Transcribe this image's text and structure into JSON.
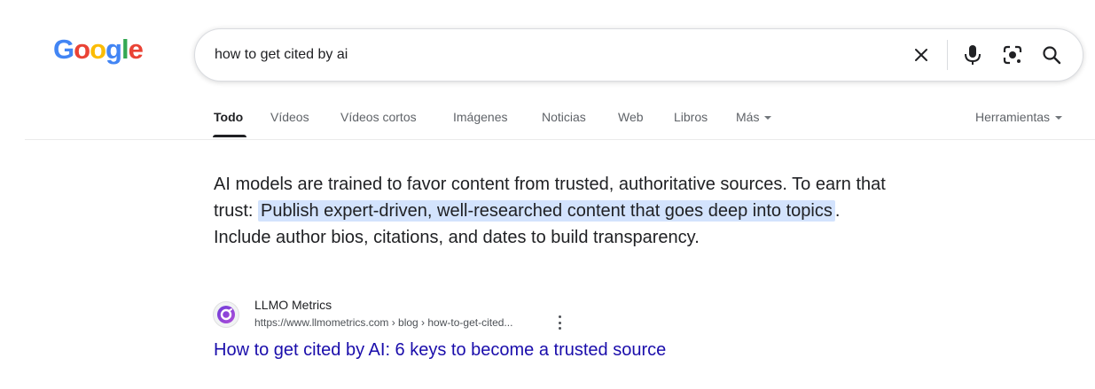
{
  "logo": {
    "letters": [
      "G",
      "o",
      "o",
      "g",
      "l",
      "e"
    ],
    "colors": [
      "#4285F4",
      "#EA4335",
      "#FBBC05",
      "#4285F4",
      "#34A853",
      "#EA4335"
    ]
  },
  "search": {
    "query": "how to get cited by ai",
    "clear_icon": "close-icon",
    "voice_icon": "microphone-icon",
    "lens_icon": "lens-camera-icon",
    "search_icon": "search-icon"
  },
  "tabs": {
    "items": [
      {
        "label": "Todo",
        "active": true
      },
      {
        "label": "Vídeos",
        "active": false
      },
      {
        "label": "Vídeos cortos",
        "active": false
      },
      {
        "label": "Imágenes",
        "active": false
      },
      {
        "label": "Noticias",
        "active": false
      },
      {
        "label": "Web",
        "active": false
      },
      {
        "label": "Libros",
        "active": false
      },
      {
        "label": "Más",
        "active": false
      }
    ],
    "tools": "Herramientas"
  },
  "snippet": {
    "before": "AI models are trained to favor content from trusted, authoritative sources. To earn that trust: ",
    "highlight": "Publish expert-driven, well-researched content that goes deep into topics",
    "after": ". Include author bios, citations, and dates to build transparency."
  },
  "result": {
    "site_name": "LLMO Metrics",
    "url": "https://www.llmometrics.com › blog › how-to-get-cited...",
    "title": "How to get cited by AI: 6 keys to become a trusted source"
  },
  "colors": {
    "link": "#1a0dab",
    "highlight": "#d3e3fd",
    "text": "#202124",
    "muted": "#5f6368"
  }
}
